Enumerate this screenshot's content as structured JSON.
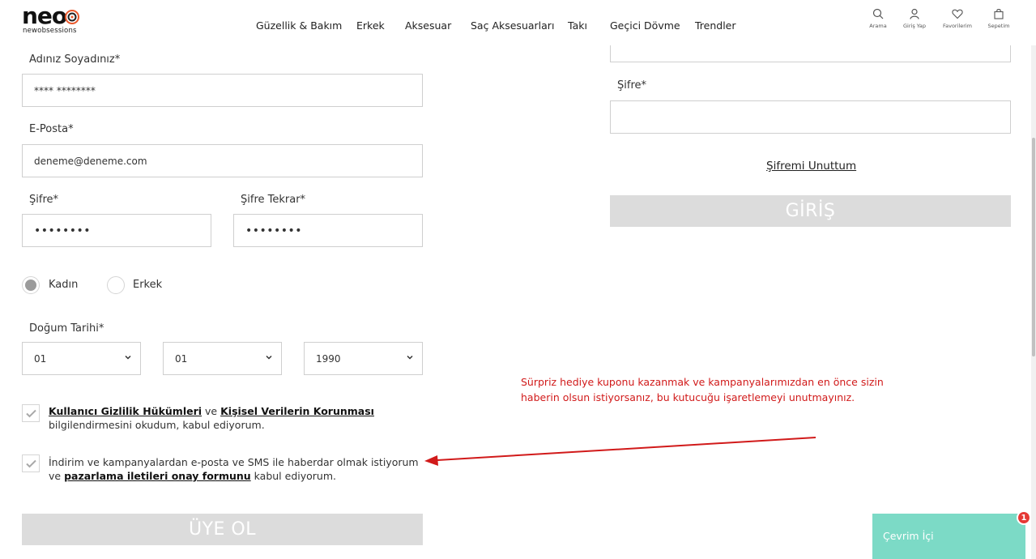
{
  "logo": {
    "word": "neo",
    "subtitle": "newobsessions"
  },
  "nav": [
    "Güzellik & Bakım",
    "Erkek",
    "Aksesuar",
    "Saç Aksesuarları",
    "Takı",
    "Geçici Dövme",
    "Trendler"
  ],
  "header_icons": [
    {
      "icon": "search-icon",
      "label": "Arama"
    },
    {
      "icon": "user-icon",
      "label": "Giriş Yap"
    },
    {
      "icon": "heart-icon",
      "label": "Favorilerim"
    },
    {
      "icon": "bag-icon",
      "label": "Sepetim"
    }
  ],
  "register": {
    "name_label": "Adınız Soyadınız*",
    "name_value": "**** ********",
    "email_label": "E-Posta*",
    "email_value": "deneme@deneme.com",
    "password_label": "Şifre*",
    "password_value": "••••••••",
    "password_repeat_label": "Şifre Tekrar*",
    "password_repeat_value": "••••••••",
    "gender_female": "Kadın",
    "gender_male": "Erkek",
    "birth_label": "Doğum Tarihi*",
    "birth_day": "01",
    "birth_month": "01",
    "birth_year": "1990",
    "consent1_link1": "Kullanıcı Gizlilik Hükümleri",
    "consent1_mid": " ve ",
    "consent1_link2": "Kişisel Verilerin Korunması",
    "consent1_tail": " bilgilendirmesini okudum, kabul ediyorum.",
    "consent2_text": "İndirim ve kampanyalardan e-posta ve SMS ile haberdar olmak istiyorum ve ",
    "consent2_link": "pazarlama iletileri onay formunu",
    "consent2_tail": " kabul ediyorum.",
    "submit": "ÜYE OL"
  },
  "login": {
    "password_label": "Şifre*",
    "forgot": "Şifremi Unuttum",
    "submit": "GİRİŞ"
  },
  "annotation": "Sürpriz hediye kuponu kazanmak ve kampanyalarımızdan en önce sizin haberin olsun istiyorsanız, bu kutucuğu işaretlemeyi unutmayınız.",
  "chat": {
    "label": "Çevrim İçi",
    "badge": "1"
  },
  "colors": {
    "annotation": "#d11a1a",
    "chat": "#7cdac6",
    "button": "#dcdcdc"
  }
}
